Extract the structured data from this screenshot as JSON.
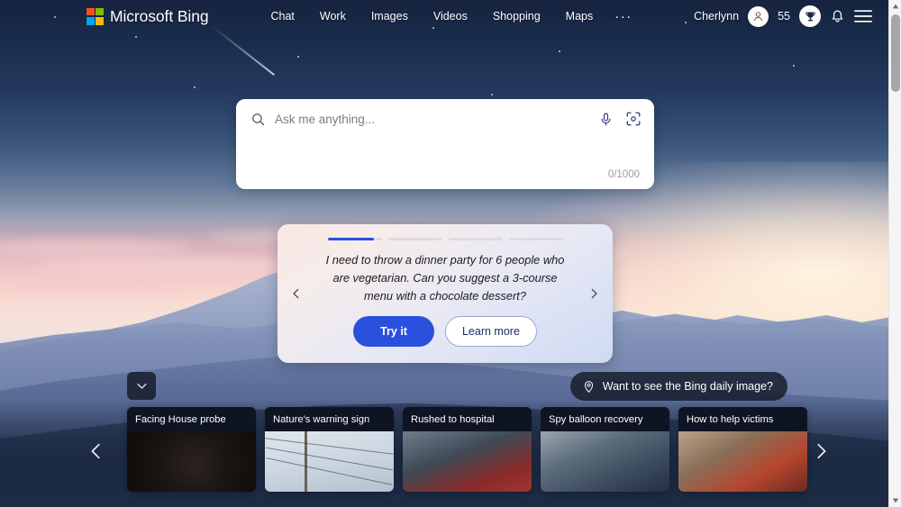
{
  "header": {
    "brand": "Microsoft Bing",
    "logo_colors": [
      "#f25022",
      "#7fba00",
      "#00a4ef",
      "#ffb900"
    ],
    "nav": [
      {
        "label": "Chat",
        "name": "nav-chat"
      },
      {
        "label": "Work",
        "name": "nav-work"
      },
      {
        "label": "Images",
        "name": "nav-images"
      },
      {
        "label": "Videos",
        "name": "nav-videos"
      },
      {
        "label": "Shopping",
        "name": "nav-shopping"
      },
      {
        "label": "Maps",
        "name": "nav-maps"
      }
    ],
    "more_label": "···",
    "user_name": "Cherlynn",
    "reward_points": "55"
  },
  "search": {
    "placeholder": "Ask me anything...",
    "value": "",
    "counter": "0/1000"
  },
  "suggestion": {
    "progress_total": 4,
    "progress_active_index": 0,
    "progress_active_fill_pct": 85,
    "prompt": "I need to throw a dinner party for 6 people who are vegetarian. Can you suggest a 3-course menu with a chocolate dessert?",
    "try_label": "Try it",
    "learn_label": "Learn more",
    "accent_color": "#2b50dd"
  },
  "daily_image": {
    "label": "Want to see the Bing daily image?"
  },
  "news": {
    "cards": [
      {
        "title": "Facing House probe",
        "image_class": "img-a"
      },
      {
        "title": "Nature's warning sign",
        "image_class": "img-b"
      },
      {
        "title": "Rushed to hospital",
        "image_class": "img-c"
      },
      {
        "title": "Spy balloon recovery",
        "image_class": "img-d"
      },
      {
        "title": "How to help victims",
        "image_class": "img-e"
      }
    ]
  }
}
